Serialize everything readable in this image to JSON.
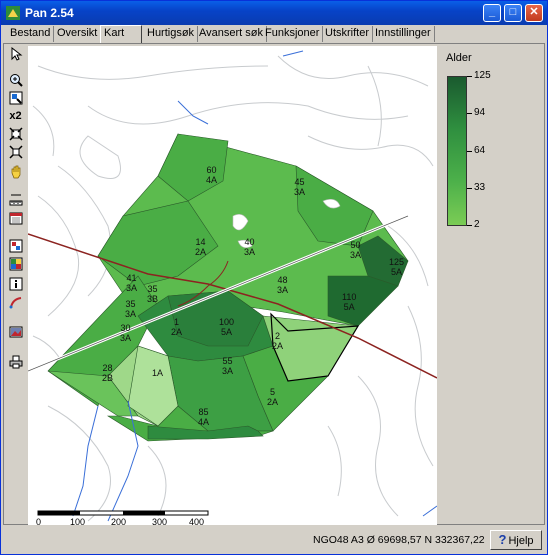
{
  "window": {
    "title": "Pan 2.54",
    "minimize": "_",
    "maximize": "□",
    "close": "✕"
  },
  "tabs": [
    {
      "label": "Bestand"
    },
    {
      "label": "Oversikt"
    },
    {
      "label": "Kart"
    },
    {
      "label": "Hurtigsøk"
    },
    {
      "label": "Avansert søk"
    },
    {
      "label": "Funksjoner"
    },
    {
      "label": "Utskrifter"
    },
    {
      "label": "Innstillinger"
    }
  ],
  "active_tab": "Kart",
  "toolbar": {
    "tools": [
      {
        "name": "pointer-tool",
        "icon": "arrow-pointer-icon"
      },
      {
        "name": "zoom-in-tool",
        "icon": "magnifier-plus-icon"
      },
      {
        "name": "zoom-window-tool",
        "icon": "zoom-window-icon"
      },
      {
        "name": "zoom-x2-tool",
        "icon": "x2-text-icon",
        "label": "x2"
      },
      {
        "name": "zoom-extent-tool",
        "icon": "zoom-extent-icon"
      },
      {
        "name": "zoom-out-tool",
        "icon": "zoom-out-icon"
      },
      {
        "name": "pan-tool",
        "icon": "hand-icon"
      },
      {
        "name": "measure-tool",
        "icon": "ruler-icon"
      },
      {
        "name": "calendar-tool",
        "icon": "calendar-icon"
      },
      {
        "name": "layers-tool",
        "icon": "layers-icon"
      },
      {
        "name": "grid-tool",
        "icon": "grid-icon"
      },
      {
        "name": "info-tool",
        "icon": "info-icon"
      },
      {
        "name": "draw-tool",
        "icon": "pen-icon"
      },
      {
        "name": "photo-tool",
        "icon": "photo-icon"
      },
      {
        "name": "print-tool",
        "icon": "printer-icon"
      }
    ]
  },
  "map": {
    "stands": [
      {
        "id": "60-4A",
        "line1": "60",
        "line2": "4A"
      },
      {
        "id": "45-3A",
        "line1": "45",
        "line2": "3A"
      },
      {
        "id": "14-2A",
        "line1": "14",
        "line2": "2A"
      },
      {
        "id": "40-3A",
        "line1": "40",
        "line2": "3A"
      },
      {
        "id": "50-3A",
        "line1": "50",
        "line2": "3A"
      },
      {
        "id": "125-5A",
        "line1": "125",
        "line2": "5A"
      },
      {
        "id": "41-3A",
        "line1": "41",
        "line2": "3A"
      },
      {
        "id": "35-3B",
        "line1": "35",
        "line2": "3B"
      },
      {
        "id": "35-3A",
        "line1": "35",
        "line2": "3A"
      },
      {
        "id": "48-3A",
        "line1": "48",
        "line2": "3A"
      },
      {
        "id": "1-2A",
        "line1": "1",
        "line2": "2A"
      },
      {
        "id": "100-5A",
        "line1": "100",
        "line2": "5A"
      },
      {
        "id": "110-5A",
        "line1": "110",
        "line2": "5A"
      },
      {
        "id": "30-3A",
        "line1": "30",
        "line2": "3A"
      },
      {
        "id": "2-2A",
        "line1": "2",
        "line2": "2A"
      },
      {
        "id": "55-3A",
        "line1": "55",
        "line2": "3A"
      },
      {
        "id": "28-2B",
        "line1": "28",
        "line2": "2B"
      },
      {
        "id": "1A",
        "line1": "1A",
        "line2": ""
      },
      {
        "id": "5-2A",
        "line1": "5",
        "line2": "2A"
      },
      {
        "id": "85-4A",
        "line1": "85",
        "line2": "4A"
      }
    ],
    "scalebar": {
      "labels": [
        "0",
        "100",
        "200",
        "300",
        "400"
      ]
    }
  },
  "legend": {
    "title": "Alder",
    "values": [
      "125",
      "94",
      "64",
      "33",
      "2"
    ],
    "colors": {
      "max": "#1a5a2f",
      "min": "#7bcc55"
    }
  },
  "status": {
    "coordinates": "NGO48 A3  Ø 69698,57  N 332367,22",
    "help_label": "Hjelp"
  }
}
